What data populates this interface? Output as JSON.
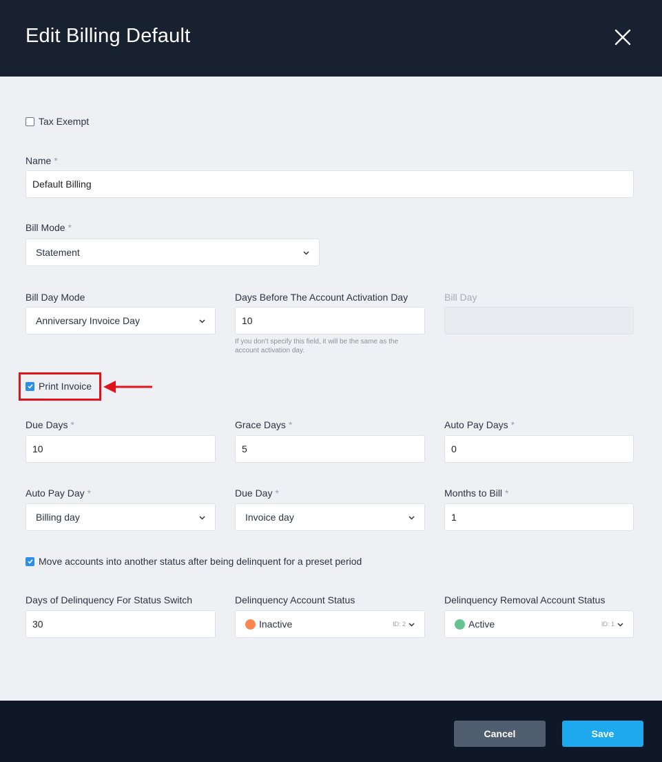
{
  "dialog": {
    "title": "Edit Billing Default"
  },
  "tax_exempt": {
    "label": "Tax Exempt",
    "checked": false
  },
  "name": {
    "label": "Name",
    "required": "*",
    "value": "Default Billing"
  },
  "bill_mode": {
    "label": "Bill Mode",
    "required": "*",
    "value": "Statement"
  },
  "bill_day_mode": {
    "label": "Bill Day Mode",
    "value": "Anniversary Invoice Day"
  },
  "days_before": {
    "label": "Days Before The Account Activation Day",
    "value": "10",
    "help_line1": "If you don't specify this field, it will be the same as the",
    "help_line2": "account activation day."
  },
  "bill_day": {
    "label": "Bill Day",
    "value": ""
  },
  "print_invoice": {
    "label": "Print Invoice",
    "checked": true
  },
  "due_days": {
    "label": "Due Days",
    "required": "*",
    "value": "10"
  },
  "grace_days": {
    "label": "Grace Days",
    "required": "*",
    "value": "5"
  },
  "auto_pay_days": {
    "label": "Auto Pay Days",
    "required": "*",
    "value": "0"
  },
  "auto_pay_day": {
    "label": "Auto Pay Day",
    "required": "*",
    "value": "Billing day"
  },
  "due_day": {
    "label": "Due Day",
    "required": "*",
    "value": "Invoice day"
  },
  "months_to_bill": {
    "label": "Months to Bill",
    "required": "*",
    "value": "1"
  },
  "move_accounts": {
    "label": "Move accounts into another status after being delinquent for a preset period",
    "checked": true
  },
  "delinquency_days": {
    "label": "Days of Delinquency For Status Switch",
    "value": "30"
  },
  "delinquency_status": {
    "label": "Delinquency Account Status",
    "value": "Inactive",
    "id_text": "ID: 2",
    "color": "#f5894f"
  },
  "removal_status": {
    "label": "Delinquency Removal Account Status",
    "value": "Active",
    "id_text": "ID: 1",
    "color": "#66c28f"
  },
  "footer": {
    "cancel_label": "Cancel",
    "save_label": "Save"
  },
  "colors": {
    "header": "#172130",
    "footer": "#0e1826",
    "accent": "#1ea9ee",
    "highlight": "#e0131b"
  },
  "icons": [
    "close-icon",
    "chevron-down-icon",
    "checkmark-icon",
    "arrow-left-icon"
  ]
}
